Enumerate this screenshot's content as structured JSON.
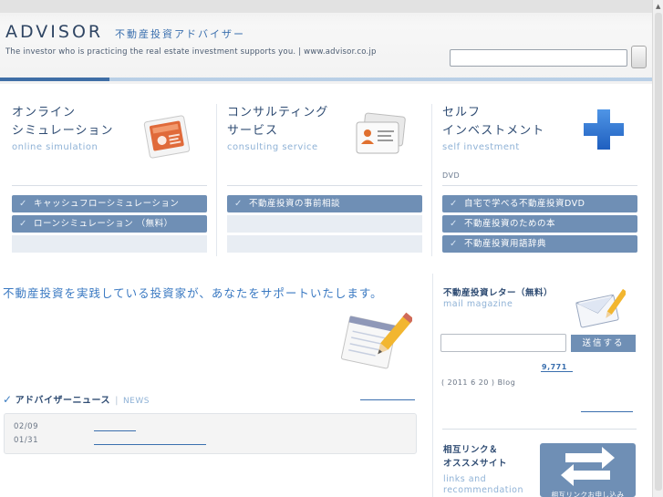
{
  "header": {
    "logo": "ADVISOR",
    "logo_jp": "不動産投資アドバイザー",
    "tagline": "The investor who is practicing the real estate investment supports you.  |  www.advisor.co.jp",
    "search_placeholder": ""
  },
  "columns": [
    {
      "title_line1": "オンライン",
      "title_line2": "シミュレーション",
      "subtitle": "online simulation",
      "icon": "presentation-icon",
      "extra": "",
      "buttons": [
        "キャッシュフローシミュレーション",
        "ローンシミュレーション （無料）"
      ]
    },
    {
      "title_line1": "コンサルティング",
      "title_line2": "サービス",
      "subtitle": "consulting service",
      "icon": "contact-card-icon",
      "extra": "",
      "buttons": [
        "不動産投資の事前相談"
      ]
    },
    {
      "title_line1": "セルフ",
      "title_line2": "インベストメント",
      "subtitle": "self investment",
      "icon": "plus-icon",
      "extra": "DVD",
      "buttons": [
        "自宅で学べる不動産投資DVD",
        "不動産投資のための本",
        "不動産投資用語辞典"
      ]
    }
  ],
  "main": {
    "lead": "不動産投資を実践している投資家が、あなたをサポートいたします。",
    "news_title": "アドバイザーニュース",
    "news_en": "NEWS",
    "news_items": [
      {
        "date": "02/09"
      },
      {
        "date": "01/31"
      }
    ]
  },
  "sidebar": {
    "mm_title": "不動産投資レター（無料）",
    "mm_sub": "mail magazine",
    "mm_button": "送信する",
    "mm_count": "9,771",
    "mm_date": "( 2011  6  20     ) Blog",
    "links_title_line1": "相互リンク＆",
    "links_title_line2": "オススメサイト",
    "links_sub_line1": "links and",
    "links_sub_line2": "recommendation",
    "banner_label": "相互リンクお申し込み"
  },
  "colors": {
    "brand_dark": "#2f4c73",
    "accent": "#3a79c2",
    "button": "#6f8fb5",
    "plus": "#2f74d0"
  }
}
